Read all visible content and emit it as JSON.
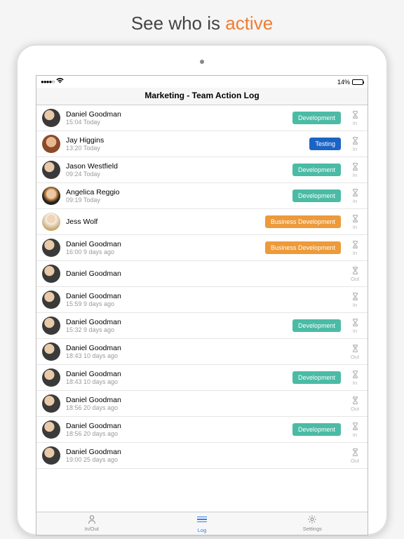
{
  "promo": {
    "prefix": "See who is ",
    "highlight": "active"
  },
  "statusBar": {
    "batteryText": "14%"
  },
  "appTitle": "Marketing - Team Action Log",
  "tags": {
    "development": {
      "label": "Development",
      "class": "development"
    },
    "testing": {
      "label": "Testing",
      "class": "testing"
    },
    "business": {
      "label": "Business Development",
      "class": "business"
    }
  },
  "entries": [
    {
      "name": "Daniel Goodman",
      "time": "15:04 Today",
      "tag": "development",
      "status": "In",
      "avatar": "av1"
    },
    {
      "name": "Jay Higgins",
      "time": "13:20 Today",
      "tag": "testing",
      "status": "In",
      "avatar": "av2"
    },
    {
      "name": "Jason Westfield",
      "time": "09:24 Today",
      "tag": "development",
      "status": "In",
      "avatar": "av1"
    },
    {
      "name": "Angelica Reggio",
      "time": "09:19 Today",
      "tag": "development",
      "status": "In",
      "avatar": "av3"
    },
    {
      "name": "Jess Wolf",
      "time": "",
      "tag": "business",
      "status": "In",
      "avatar": "av4"
    },
    {
      "name": "Daniel Goodman",
      "time": "16:00 9 days ago",
      "tag": "business",
      "status": "In",
      "avatar": "av1"
    },
    {
      "name": "Daniel Goodman",
      "time": "",
      "tag": null,
      "status": "Out",
      "avatar": "av1"
    },
    {
      "name": "Daniel Goodman",
      "time": "15:59 9 days ago",
      "tag": null,
      "status": "In",
      "avatar": "av1"
    },
    {
      "name": "Daniel Goodman",
      "time": "15:32 9 days ago",
      "tag": "development",
      "status": "In",
      "avatar": "av1"
    },
    {
      "name": "Daniel Goodman",
      "time": "18:43 10 days ago",
      "tag": null,
      "status": "Out",
      "avatar": "av1"
    },
    {
      "name": "Daniel Goodman",
      "time": "18:43 10 days ago",
      "tag": "development",
      "status": "In",
      "avatar": "av1"
    },
    {
      "name": "Daniel Goodman",
      "time": "18:56 20 days ago",
      "tag": null,
      "status": "Out",
      "avatar": "av1"
    },
    {
      "name": "Daniel Goodman",
      "time": "18:56 20 days ago",
      "tag": "development",
      "status": "In",
      "avatar": "av1"
    },
    {
      "name": "Daniel Goodman",
      "time": "19:00 25 days ago",
      "tag": null,
      "status": "Out",
      "avatar": "av1"
    }
  ],
  "tabs": [
    {
      "label": "In/Out",
      "icon": "person",
      "active": false
    },
    {
      "label": "Log",
      "icon": "lines",
      "active": true
    },
    {
      "label": "Settings",
      "icon": "gear",
      "active": false
    }
  ]
}
